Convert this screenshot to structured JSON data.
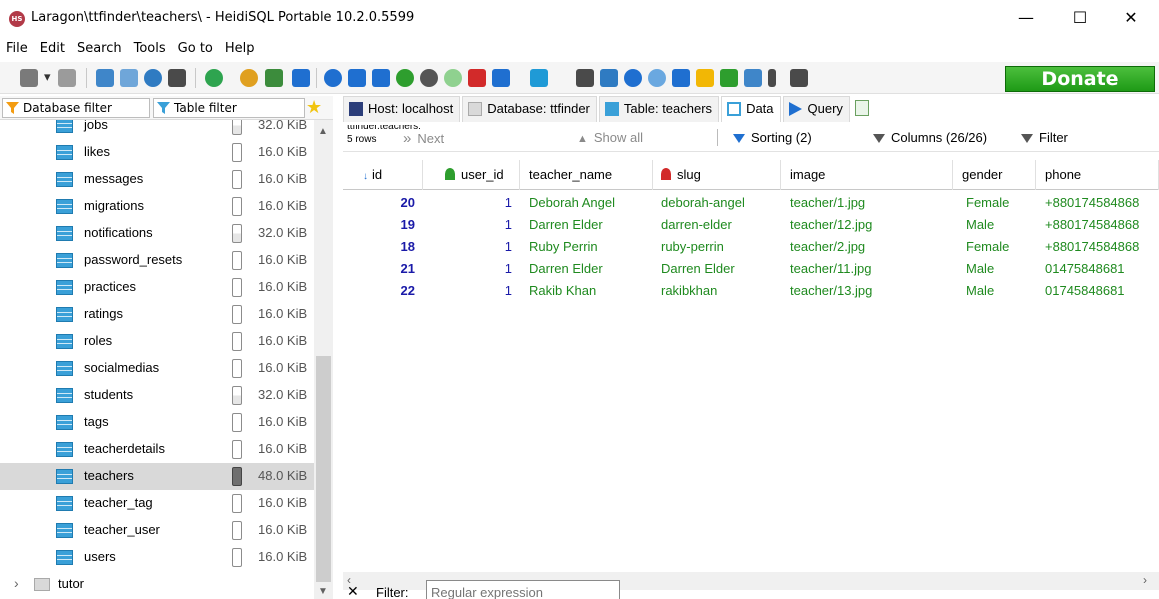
{
  "window": {
    "title": "Laragon\\ttfinder\\teachers\\ - HeidiSQL Portable 10.2.0.5599",
    "app_icon_text": "HS",
    "minimize": "—",
    "maximize": "☐",
    "close": "✕"
  },
  "menu": [
    "File",
    "Edit",
    "Search",
    "Tools",
    "Go to",
    "Help"
  ],
  "toolbar": {
    "donate_label": "Donate"
  },
  "filters": {
    "database_filter": "Database filter",
    "table_filter": "Table filter",
    "favorite": "★"
  },
  "tree": {
    "tables": [
      {
        "name": "jobs",
        "size": "32.0 KiB",
        "fill": "half"
      },
      {
        "name": "likes",
        "size": "16.0 KiB",
        "fill": "empty"
      },
      {
        "name": "messages",
        "size": "16.0 KiB",
        "fill": "empty"
      },
      {
        "name": "migrations",
        "size": "16.0 KiB",
        "fill": "empty"
      },
      {
        "name": "notifications",
        "size": "32.0 KiB",
        "fill": "half"
      },
      {
        "name": "password_resets",
        "size": "16.0 KiB",
        "fill": "empty"
      },
      {
        "name": "practices",
        "size": "16.0 KiB",
        "fill": "empty"
      },
      {
        "name": "ratings",
        "size": "16.0 KiB",
        "fill": "empty"
      },
      {
        "name": "roles",
        "size": "16.0 KiB",
        "fill": "empty"
      },
      {
        "name": "socialmedias",
        "size": "16.0 KiB",
        "fill": "empty"
      },
      {
        "name": "students",
        "size": "32.0 KiB",
        "fill": "half"
      },
      {
        "name": "tags",
        "size": "16.0 KiB",
        "fill": "empty"
      },
      {
        "name": "teacherdetails",
        "size": "16.0 KiB",
        "fill": "empty"
      },
      {
        "name": "teachers",
        "size": "48.0 KiB",
        "fill": "full",
        "selected": true
      },
      {
        "name": "teacher_tag",
        "size": "16.0 KiB",
        "fill": "empty"
      },
      {
        "name": "teacher_user",
        "size": "16.0 KiB",
        "fill": "empty"
      },
      {
        "name": "users",
        "size": "16.0 KiB",
        "fill": "empty"
      }
    ],
    "next_database": {
      "name": "tutor",
      "chevron": "›"
    }
  },
  "tabs": {
    "host": "Host: localhost",
    "database": "Database: ttfinder",
    "table": "Table: teachers",
    "data": "Data",
    "query": "Query"
  },
  "data_toolbar": {
    "table_label": "ttfinder.teachers:",
    "rows": "5 rows",
    "next": "Next",
    "show_all": "Show all",
    "sorting": "Sorting (2)",
    "columns": "Columns (26/26)",
    "filter": "Filter"
  },
  "grid": {
    "columns": [
      "id",
      "user_id",
      "teacher_name",
      "slug",
      "image",
      "gender",
      "phone"
    ],
    "rows": [
      {
        "id": "20",
        "user_id": "1",
        "teacher_name": "Deborah Angel",
        "slug": "deborah-angel",
        "image": "teacher/1.jpg",
        "gender": "Female",
        "phone": "+880174584868"
      },
      {
        "id": "19",
        "user_id": "1",
        "teacher_name": "Darren Elder",
        "slug": "darren-elder",
        "image": "teacher/12.jpg",
        "gender": "Male",
        "phone": "+880174584868"
      },
      {
        "id": "18",
        "user_id": "1",
        "teacher_name": "Ruby Perrin",
        "slug": "ruby-perrin",
        "image": "teacher/2.jpg",
        "gender": "Female",
        "phone": "+880174584868"
      },
      {
        "id": "21",
        "user_id": "1",
        "teacher_name": "Darren Elder",
        "slug": "Darren Elder",
        "image": "teacher/11.jpg",
        "gender": "Male",
        "phone": "01475848681"
      },
      {
        "id": "22",
        "user_id": "1",
        "teacher_name": "Rakib Khan",
        "slug": "rakibkhan",
        "image": "teacher/13.jpg",
        "gender": "Male",
        "phone": "01745848681"
      }
    ]
  },
  "filter_bar": {
    "close": "✕",
    "label": "Filter:",
    "placeholder": "Regular expression"
  },
  "colors": {
    "donate": "#1e9a16",
    "string_value": "#1f8a1f",
    "number_value": "#1a1aa8",
    "accent": "#1f6fd0"
  }
}
